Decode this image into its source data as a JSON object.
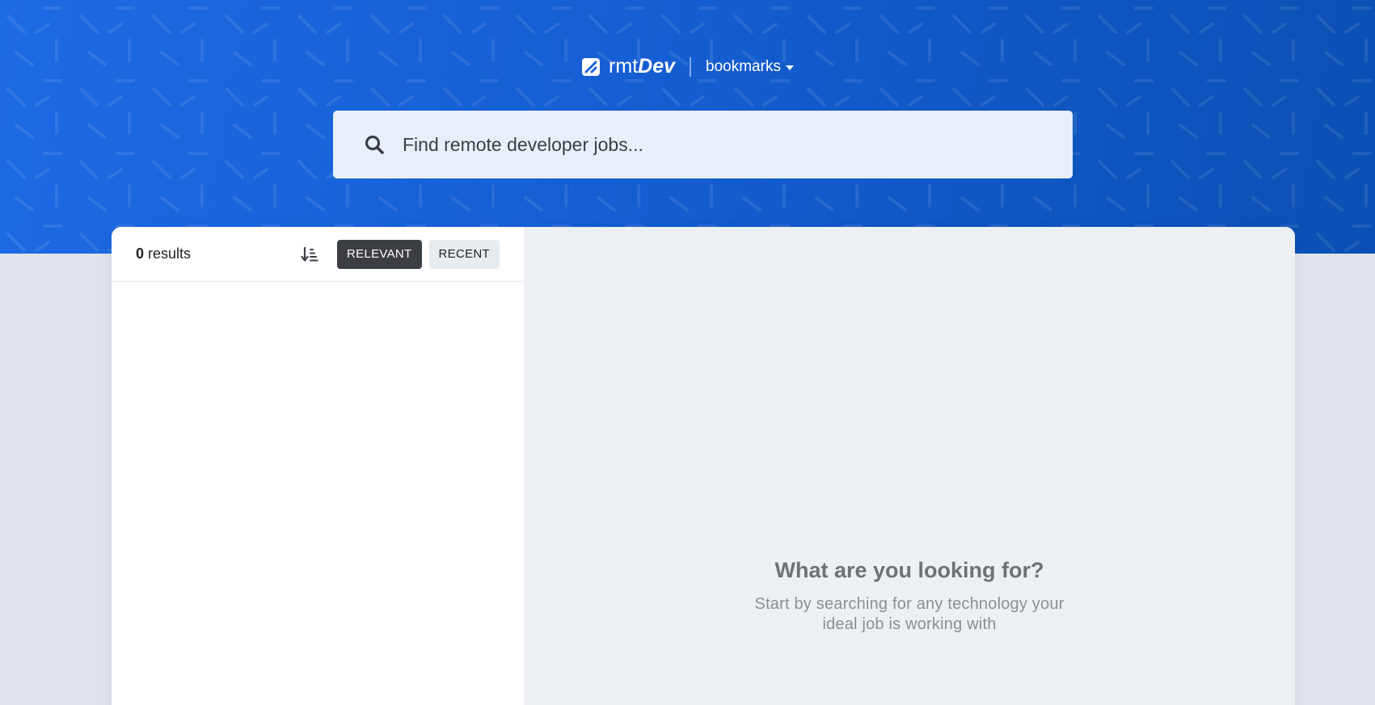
{
  "header": {
    "logo": {
      "prefix": "rmt",
      "suffix": "Dev"
    },
    "bookmarks_label": "bookmarks"
  },
  "search": {
    "placeholder": "Find remote developer jobs...",
    "value": ""
  },
  "sidebar": {
    "results_count": "0",
    "results_label": "results",
    "sort_buttons": [
      {
        "label": "RELEVANT",
        "active": true
      },
      {
        "label": "RECENT",
        "active": false
      }
    ]
  },
  "detail": {
    "empty_title": "What are you looking for?",
    "empty_subtitle": "Start by searching for any technology your ideal job is working with"
  },
  "colors": {
    "hero_start": "#1d6ae5",
    "hero_end": "#0a4fb3",
    "active_sort": "#3b3e42",
    "inactive_sort": "#e6ebef",
    "detail_bg": "#ecf0f3"
  },
  "icons": {
    "logo": "logo-icon",
    "bookmarks_caret": "caret-down-icon",
    "search": "search-icon",
    "sort": "sort-icon"
  }
}
